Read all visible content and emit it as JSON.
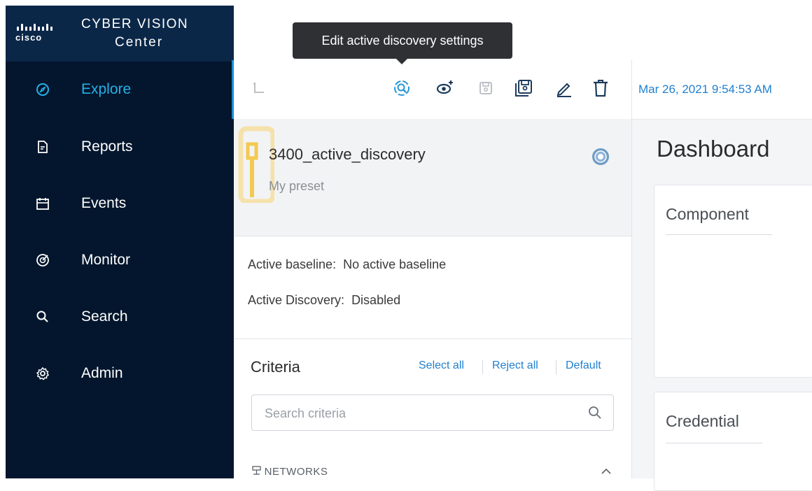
{
  "brand": {
    "logo_text": "cisco",
    "title": "CYBER VISION",
    "subtitle": "Center"
  },
  "nav": {
    "items": [
      {
        "label": "Explore",
        "icon": "compass-icon",
        "active": true
      },
      {
        "label": "Reports",
        "icon": "document-icon",
        "active": false
      },
      {
        "label": "Events",
        "icon": "calendar-icon",
        "active": false
      },
      {
        "label": "Monitor",
        "icon": "monitor-target-icon",
        "active": false
      },
      {
        "label": "Search",
        "icon": "search-icon",
        "active": false
      },
      {
        "label": "Admin",
        "icon": "gear-icon",
        "active": false
      }
    ]
  },
  "tooltip": {
    "text": "Edit active discovery settings"
  },
  "toolbar": {
    "buttons": [
      "back-icon",
      "active-discovery-icon",
      "add-view-icon",
      "save-icon",
      "save-as-icon",
      "edit-icon",
      "trash-icon"
    ]
  },
  "preset": {
    "name": "3400_active_discovery",
    "description": "My preset"
  },
  "info": {
    "baseline_label": "Active baseline:",
    "baseline_value": "No active baseline",
    "discovery_label": "Active Discovery:",
    "discovery_value": "Disabled"
  },
  "criteria": {
    "title": "Criteria",
    "select_all": "Select all",
    "reject_all": "Reject all",
    "default": "Default",
    "search_placeholder": "Search criteria",
    "section_networks": "NETWORKS"
  },
  "header": {
    "timestamp": "Mar 26, 2021 9:54:53 AM"
  },
  "dashboard": {
    "title": "Dashboard",
    "widgets": [
      "Component",
      "Credential"
    ]
  },
  "colors": {
    "sidebar_bg": "#03162d",
    "brand_bg": "#0b2748",
    "accent": "#1f7fcf",
    "active_nav": "#27b0e8",
    "tooltip_bg": "#2e3033"
  }
}
